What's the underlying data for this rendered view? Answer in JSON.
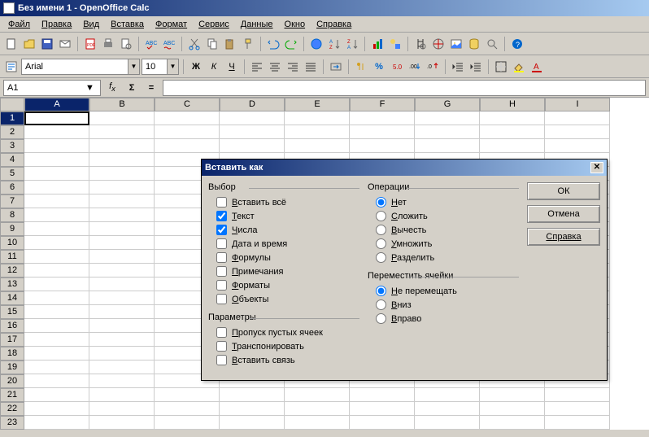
{
  "title": "Без имени 1 - OpenOffice Calc",
  "menus": [
    "Файл",
    "Правка",
    "Вид",
    "Вставка",
    "Формат",
    "Сервис",
    "Данные",
    "Окно",
    "Справка"
  ],
  "font": {
    "name": "Arial",
    "size": "10"
  },
  "cellref": "A1",
  "columns": [
    "A",
    "B",
    "C",
    "D",
    "E",
    "F",
    "G",
    "H",
    "I"
  ],
  "rows": [
    "1",
    "2",
    "3",
    "4",
    "5",
    "6",
    "7",
    "8",
    "9",
    "10",
    "11",
    "12",
    "13",
    "14",
    "15",
    "16",
    "17",
    "18",
    "19",
    "20",
    "21",
    "22",
    "23"
  ],
  "dialog": {
    "title": "Вставить как",
    "groups": {
      "select": {
        "label": "Выбор",
        "items": [
          {
            "label": "Вставить всё",
            "u": "В",
            "checked": false
          },
          {
            "label": "Текст",
            "u": "Т",
            "checked": true
          },
          {
            "label": "Числа",
            "u": "Ч",
            "checked": true
          },
          {
            "label": "Дата и время",
            "u": "Д",
            "checked": false
          },
          {
            "label": "Формулы",
            "u": "Ф",
            "checked": false
          },
          {
            "label": "Примечания",
            "u": "П",
            "checked": false
          },
          {
            "label": "Форматы",
            "u": "Ф",
            "checked": false
          },
          {
            "label": "Объекты",
            "u": "О",
            "checked": false
          }
        ]
      },
      "ops": {
        "label": "Операции",
        "items": [
          {
            "label": "Нет",
            "u": "Н",
            "checked": true
          },
          {
            "label": "Сложить",
            "u": "С",
            "checked": false
          },
          {
            "label": "Вычесть",
            "u": "В",
            "checked": false
          },
          {
            "label": "Умножить",
            "u": "У",
            "checked": false
          },
          {
            "label": "Разделить",
            "u": "Р",
            "checked": false
          }
        ]
      },
      "params": {
        "label": "Параметры",
        "items": [
          {
            "label": "Пропуск пустых ячеек",
            "u": "П",
            "checked": false
          },
          {
            "label": "Транспонировать",
            "u": "Т",
            "checked": false
          },
          {
            "label": "Вставить связь",
            "u": "В",
            "checked": false
          }
        ]
      },
      "shift": {
        "label": "Переместить ячейки",
        "items": [
          {
            "label": "Не перемещать",
            "u": "Н",
            "checked": true
          },
          {
            "label": "Вниз",
            "u": "В",
            "checked": false
          },
          {
            "label": "Вправо",
            "u": "В",
            "checked": false
          }
        ]
      }
    },
    "buttons": {
      "ok": "ОК",
      "cancel": "Отмена",
      "help": "Справка"
    }
  }
}
